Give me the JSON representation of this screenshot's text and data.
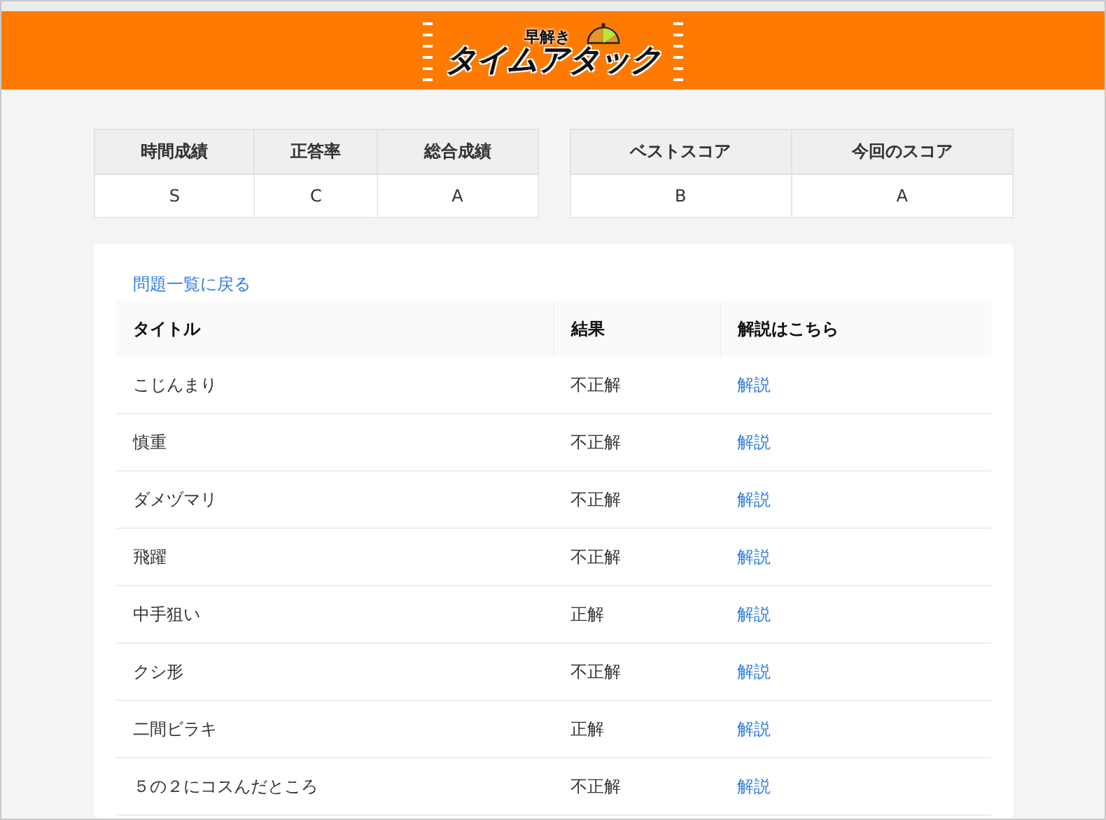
{
  "logo": {
    "small": "早解き",
    "main": "タイムアタック"
  },
  "score_tables": [
    {
      "columns": [
        "時間成績",
        "正答率",
        "総合成績"
      ],
      "values": [
        "S",
        "C",
        "A"
      ]
    },
    {
      "columns": [
        "ベストスコア",
        "今回のスコア"
      ],
      "values": [
        "B",
        "A"
      ]
    }
  ],
  "back_link": "問題一覧に戻る",
  "results": {
    "columns": [
      "タイトル",
      "結果",
      "解説はこちら"
    ],
    "rows": [
      {
        "title": "こじんまり",
        "result": "不正解",
        "link": "解説"
      },
      {
        "title": "慎重",
        "result": "不正解",
        "link": "解説"
      },
      {
        "title": "ダメヅマリ",
        "result": "不正解",
        "link": "解説"
      },
      {
        "title": "飛躍",
        "result": "不正解",
        "link": "解説"
      },
      {
        "title": "中手狙い",
        "result": "正解",
        "link": "解説"
      },
      {
        "title": "クシ形",
        "result": "不正解",
        "link": "解説"
      },
      {
        "title": "二間ビラキ",
        "result": "正解",
        "link": "解説"
      },
      {
        "title": "５の２にコスんだところ",
        "result": "不正解",
        "link": "解説"
      }
    ]
  }
}
